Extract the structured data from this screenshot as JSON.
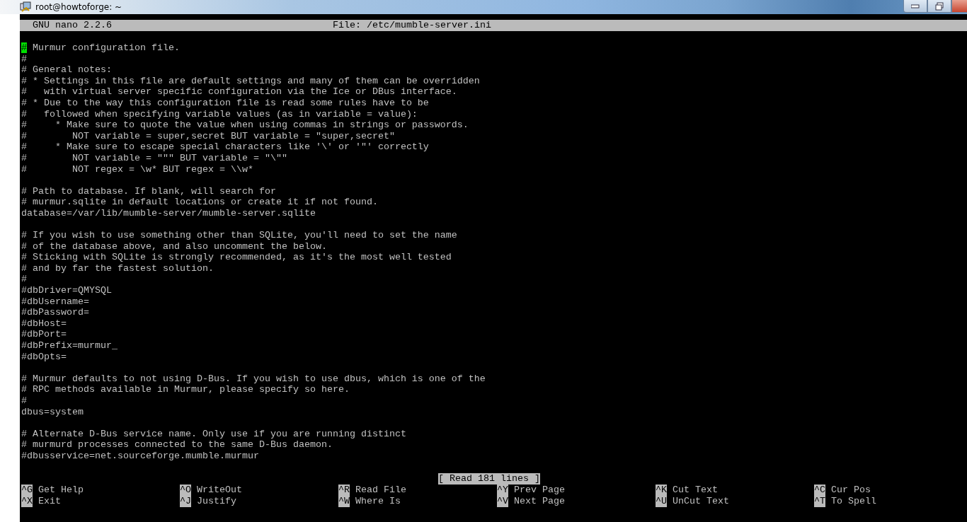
{
  "window": {
    "title": "root@howtoforge: ~"
  },
  "header": {
    "app": "GNU nano 2.2.6",
    "file": "File: /etc/mumble-server.ini"
  },
  "lines": [
    {
      "kind": "text",
      "text": "# Murmur configuration file.",
      "cursor": true
    },
    {
      "kind": "text",
      "text": "#",
      "cursor": false
    },
    {
      "kind": "text",
      "text": "# General notes:",
      "cursor": false
    },
    {
      "kind": "text",
      "text": "# * Settings in this file are default settings and many of them can be overridden",
      "cursor": false
    },
    {
      "kind": "text",
      "text": "#   with virtual server specific configuration via the Ice or DBus interface.",
      "cursor": false
    },
    {
      "kind": "text",
      "text": "# * Due to the way this configuration file is read some rules have to be",
      "cursor": false
    },
    {
      "kind": "text",
      "text": "#   followed when specifying variable values (as in variable = value):",
      "cursor": false
    },
    {
      "kind": "text",
      "text": "#     * Make sure to quote the value when using commas in strings or passwords.",
      "cursor": false
    },
    {
      "kind": "text",
      "text": "#        NOT variable = super,secret BUT variable = \"super,secret\"",
      "cursor": false
    },
    {
      "kind": "text",
      "text": "#     * Make sure to escape special characters like '\\' or '\"' correctly",
      "cursor": false
    },
    {
      "kind": "text",
      "text": "#        NOT variable = \"\"\" BUT variable = \"\\\"\"",
      "cursor": false
    },
    {
      "kind": "text",
      "text": "#        NOT regex = \\w* BUT regex = \\\\w*",
      "cursor": false
    },
    {
      "kind": "blank"
    },
    {
      "kind": "text",
      "text": "# Path to database. If blank, will search for",
      "cursor": false
    },
    {
      "kind": "text",
      "text": "# murmur.sqlite in default locations or create it if not found.",
      "cursor": false
    },
    {
      "kind": "text",
      "text": "database=/var/lib/mumble-server/mumble-server.sqlite",
      "cursor": false
    },
    {
      "kind": "blank"
    },
    {
      "kind": "text",
      "text": "# If you wish to use something other than SQLite, you'll need to set the name",
      "cursor": false
    },
    {
      "kind": "text",
      "text": "# of the database above, and also uncomment the below.",
      "cursor": false
    },
    {
      "kind": "text",
      "text": "# Sticking with SQLite is strongly recommended, as it's the most well tested",
      "cursor": false
    },
    {
      "kind": "text",
      "text": "# and by far the fastest solution.",
      "cursor": false
    },
    {
      "kind": "text",
      "text": "#",
      "cursor": false
    },
    {
      "kind": "text",
      "text": "#dbDriver=QMYSQL",
      "cursor": false
    },
    {
      "kind": "text",
      "text": "#dbUsername=",
      "cursor": false
    },
    {
      "kind": "text",
      "text": "#dbPassword=",
      "cursor": false
    },
    {
      "kind": "text",
      "text": "#dbHost=",
      "cursor": false
    },
    {
      "kind": "text",
      "text": "#dbPort=",
      "cursor": false
    },
    {
      "kind": "text",
      "text": "#dbPrefix=murmur_",
      "cursor": false
    },
    {
      "kind": "text",
      "text": "#dbOpts=",
      "cursor": false
    },
    {
      "kind": "blank"
    },
    {
      "kind": "text",
      "text": "# Murmur defaults to not using D-Bus. If you wish to use dbus, which is one of the",
      "cursor": false
    },
    {
      "kind": "text",
      "text": "# RPC methods available in Murmur, please specify so here.",
      "cursor": false
    },
    {
      "kind": "text",
      "text": "#",
      "cursor": false
    },
    {
      "kind": "text",
      "text": "dbus=system",
      "cursor": false
    },
    {
      "kind": "blank"
    },
    {
      "kind": "text",
      "text": "# Alternate D-Bus service name. Only use if you are running distinct",
      "cursor": false
    },
    {
      "kind": "text",
      "text": "# murmurd processes connected to the same D-Bus daemon.",
      "cursor": false
    },
    {
      "kind": "text",
      "text": "#dbusservice=net.sourceforge.mumble.murmur",
      "cursor": false
    }
  ],
  "status": "[ Read 181 lines ]",
  "shortcuts": [
    [
      {
        "key": "^G",
        "label": "Get Help"
      },
      {
        "key": "^O",
        "label": "WriteOut"
      },
      {
        "key": "^R",
        "label": "Read File"
      },
      {
        "key": "^Y",
        "label": "Prev Page"
      },
      {
        "key": "^K",
        "label": "Cut Text"
      },
      {
        "key": "^C",
        "label": "Cur Pos"
      }
    ],
    [
      {
        "key": "^X",
        "label": "Exit"
      },
      {
        "key": "^J",
        "label": "Justify"
      },
      {
        "key": "^W",
        "label": "Where Is"
      },
      {
        "key": "^V",
        "label": "Next Page"
      },
      {
        "key": "^U",
        "label": "UnCut Text"
      },
      {
        "key": "^T",
        "label": "To Spell"
      }
    ]
  ]
}
